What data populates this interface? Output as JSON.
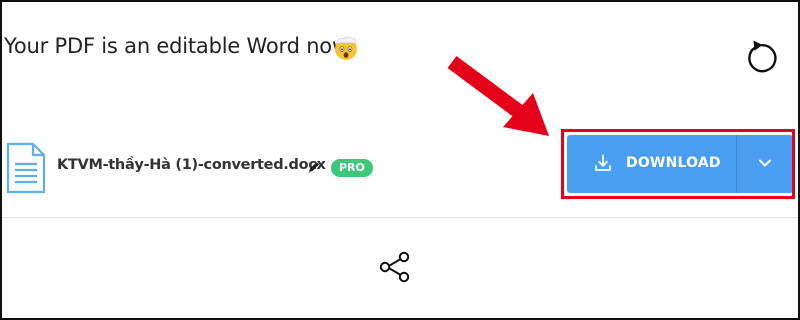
{
  "header": {
    "message": "Your PDF is an editable Word now.",
    "emoji_icon": "exploding-head-icon",
    "reload_icon": "reload-icon"
  },
  "file": {
    "icon": "document-icon",
    "name": "KTVM-thầy-Hà (1)-converted.docx",
    "edit_icon": "pencil-icon",
    "badge": "PRO"
  },
  "download": {
    "label": "DOWNLOAD",
    "icon": "download-icon",
    "dropdown_icon": "chevron-down-icon"
  },
  "share": {
    "icon": "share-icon"
  },
  "colors": {
    "button": "#4a9ef2",
    "badge": "#3ec87c",
    "annotation": "#e5001a",
    "file_icon": "#5fb0e8"
  }
}
